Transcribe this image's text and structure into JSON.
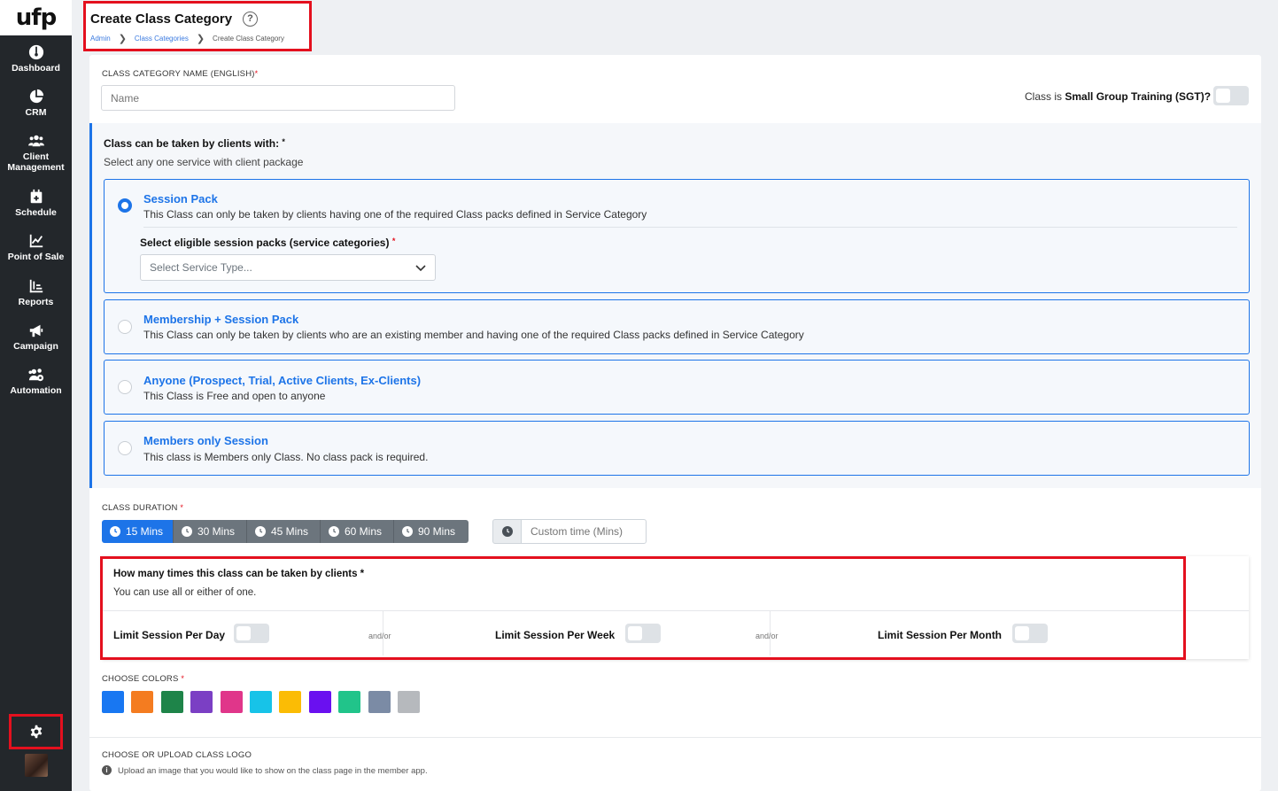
{
  "sidebar": {
    "logo": "ufp",
    "items": [
      {
        "label": "Dashboard",
        "icon": "dashboard-icon"
      },
      {
        "label": "CRM",
        "icon": "pie-chart-icon"
      },
      {
        "label": "Client Management",
        "icon": "users-icon"
      },
      {
        "label": "Schedule",
        "icon": "calendar-icon"
      },
      {
        "label": "Point of Sale",
        "icon": "line-chart-icon"
      },
      {
        "label": "Reports",
        "icon": "bar-chart-icon"
      },
      {
        "label": "Campaign",
        "icon": "megaphone-icon"
      },
      {
        "label": "Automation",
        "icon": "users-gear-icon"
      }
    ],
    "settings_icon": "gear-icon"
  },
  "header": {
    "title": "Create Class Category",
    "help": "?",
    "breadcrumb": [
      "Admin",
      "Class Categories",
      "Create Class Category"
    ]
  },
  "category_name": {
    "label": "CLASS CATEGORY NAME (ENGLISH)",
    "placeholder": "Name",
    "sgt_prefix": "Class is",
    "sgt_bold": "Small Group Training (SGT)?"
  },
  "service": {
    "title": "Class can be taken by clients with:",
    "subtitle": "Select any one service with client package",
    "options": [
      {
        "title": "Session Pack",
        "desc": "This Class can only be taken by clients having one of the required Class packs defined in Service Category",
        "selected": true
      },
      {
        "title": "Membership + Session Pack",
        "desc": "This Class can only be taken by clients who are an existing member and having one of the required Class packs defined in Service Category",
        "selected": false
      },
      {
        "title": "Anyone (Prospect, Trial, Active Clients, Ex-Clients)",
        "desc": "This Class is Free and open to anyone",
        "selected": false
      },
      {
        "title": "Members only Session",
        "desc": "This class is Members only Class. No class pack is required.",
        "selected": false
      }
    ],
    "select_label": "Select eligible session packs (service categories)",
    "select_placeholder": "Select Service Type..."
  },
  "duration": {
    "label": "CLASS DURATION",
    "options": [
      "15 Mins",
      "30 Mins",
      "45 Mins",
      "60 Mins",
      "90 Mins"
    ],
    "selected": "15 Mins",
    "custom_placeholder": "Custom time (Mins)"
  },
  "limits": {
    "title": "How many times this class can be taken by clients *",
    "subtitle": "You can use all or either of one.",
    "per_day": "Limit Session Per Day",
    "per_week": "Limit Session Per Week",
    "per_month": "Limit Session Per Month",
    "andor": "and/or"
  },
  "colors": {
    "label": "CHOOSE COLORS",
    "swatches": [
      "#1877f2",
      "#f47c20",
      "#1e8449",
      "#7b3fc4",
      "#e0368a",
      "#17c3e8",
      "#fbbc05",
      "#6a10f0",
      "#21c48a",
      "#7b8ba5",
      "#b6b9bd"
    ]
  },
  "logo_upload": {
    "label": "CHOOSE OR UPLOAD CLASS LOGO",
    "info": "Upload an image that you would like to show on the class page in the member app."
  }
}
